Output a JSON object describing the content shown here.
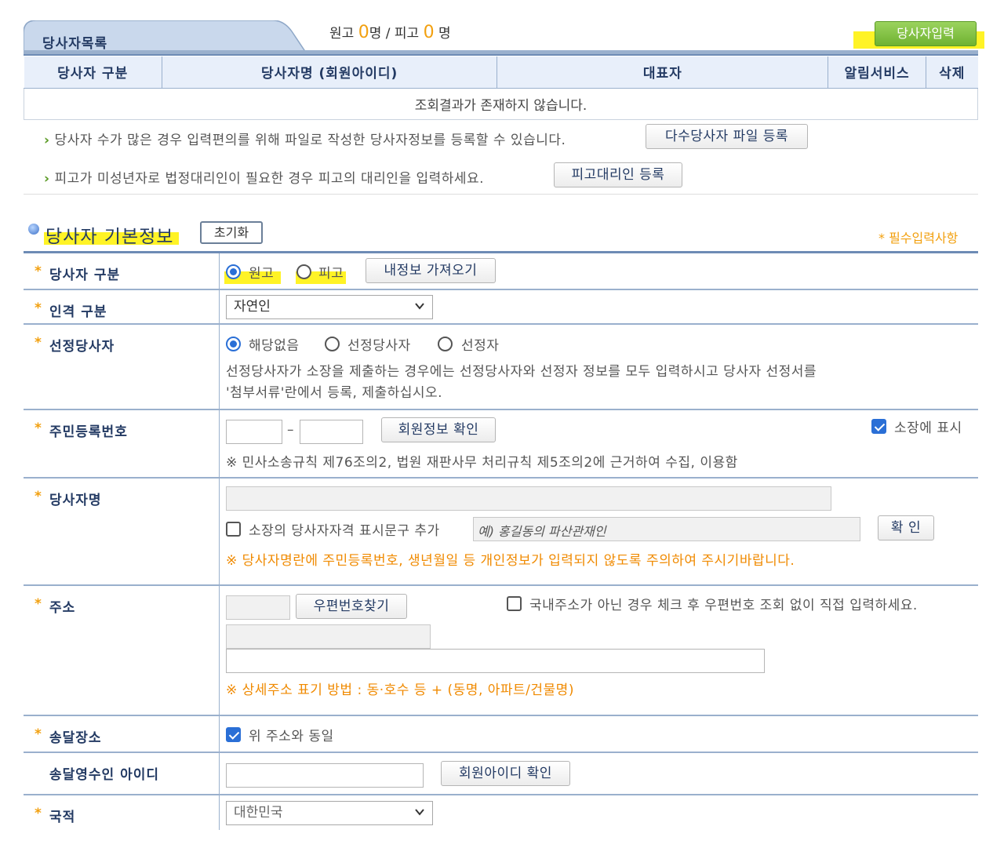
{
  "party_list": {
    "tab_label": "당사자목록",
    "counts": {
      "plaintiff_label": "원고",
      "plaintiff_count": "0",
      "plaintiff_unit": "명 /",
      "defendant_label": "피고",
      "defendant_count": "0",
      "defendant_unit": "명"
    },
    "add_button": "당사자입력",
    "columns": [
      "당사자 구분",
      "당사자명 (회원아이디)",
      "대표자",
      "알림서비스",
      "삭제"
    ],
    "empty_message": "조회결과가 존재하지 않습니다.",
    "info_file": "당사자 수가 많은 경우 입력편의를 위해 파일로 작성한 당사자정보를 등록할 수 있습니다.",
    "file_button": "다수당사자 파일 등록",
    "info_agent": "피고가 미성년자로 법정대리인이 필요한 경우 피고의 대리인을 입력하세요.",
    "agent_button": "피고대리인 등록"
  },
  "basic_info": {
    "title": "당사자 기본정보",
    "reset_button": "초기화",
    "required_note": "* 필수입력사항",
    "star": "*",
    "rows": {
      "party_type": {
        "label": "당사자 구분",
        "options": [
          "원고",
          "피고"
        ],
        "fetch_button": "내정보 가져오기"
      },
      "person_type": {
        "label": "인격 구분",
        "selected": "자연인"
      },
      "designated": {
        "label": "선정당사자",
        "options": [
          "해당없음",
          "선정당사자",
          "선정자"
        ],
        "help_1": "선정당사자가 소장을 제출하는 경우에는 선정당사자와 선정자 정보를 모두 입력하시고 당사자 선정서를",
        "help_2": "'첨부서류'란에서 등록, 제출하십시오."
      },
      "resident_no": {
        "label": "주민등록번호",
        "dash": "–",
        "verify_button": "회원정보 확인",
        "show_label": "소장에 표시",
        "legal_note": "※ 민사소송규칙 제76조의2, 법원 재판사무 처리규칙 제5조의2에 근거하여 수집, 이용함"
      },
      "party_name": {
        "label": "당사자명",
        "qual_label": "소장의 당사자자격 표시문구 추가",
        "qual_placeholder": "예) 홍길동의 파산관재인",
        "confirm_button": "확 인",
        "warning": "※ 당사자명란에 주민등록번호, 생년월일 등 개인정보가 입력되지 않도록 주의하여 주시기바랍니다."
      },
      "address": {
        "label": "주소",
        "zip_button": "우편번호찾기",
        "foreign_label": "국내주소가 아닌 경우 체크 후 우편번호 조회 없이 직접 입력하세요.",
        "detail_note": "※ 상세주소 표기 방법 : 동·호수 등 + (동명, 아파트/건물명)"
      },
      "delivery": {
        "label": "송달장소",
        "same_label": "위 주소와 동일"
      },
      "recipient_id": {
        "label": "송달영수인 아이디",
        "check_button": "회원아이디 확인"
      },
      "nationality": {
        "label": "국적",
        "selected": "대한민국"
      }
    }
  },
  "colors": {
    "accent_blue": "#2a6fd6",
    "header_navy": "#233a63",
    "required_orange": "#f2a00f",
    "highlight_yellow": "#fff100",
    "add_green": "#6fb231"
  }
}
